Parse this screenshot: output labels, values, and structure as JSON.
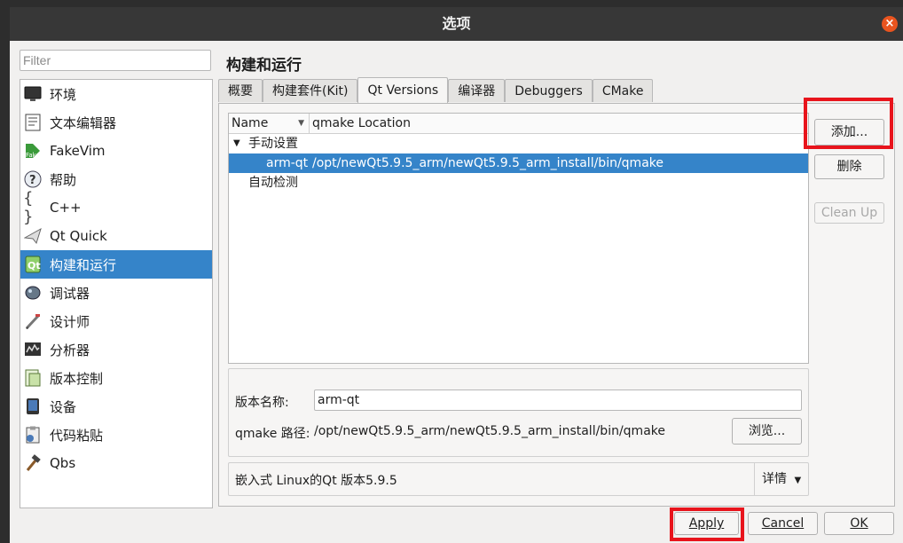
{
  "window": {
    "title": "选项"
  },
  "filter": {
    "placeholder": "Filter"
  },
  "sidebar": {
    "items": [
      {
        "label": "环境",
        "icon": "monitor-icon"
      },
      {
        "label": "文本编辑器",
        "icon": "text-editor-icon"
      },
      {
        "label": "FakeVim",
        "icon": "fakevim-icon"
      },
      {
        "label": "帮助",
        "icon": "help-icon"
      },
      {
        "label": "C++",
        "icon": "cpp-braces-icon"
      },
      {
        "label": "Qt Quick",
        "icon": "paper-plane-icon"
      },
      {
        "label": "构建和运行",
        "icon": "build-run-icon"
      },
      {
        "label": "调试器",
        "icon": "debugger-icon"
      },
      {
        "label": "设计师",
        "icon": "designer-icon"
      },
      {
        "label": "分析器",
        "icon": "analyzer-icon"
      },
      {
        "label": "版本控制",
        "icon": "version-control-icon"
      },
      {
        "label": "设备",
        "icon": "device-icon"
      },
      {
        "label": "代码粘贴",
        "icon": "code-paste-icon"
      },
      {
        "label": "Qbs",
        "icon": "hammer-icon"
      }
    ],
    "selected": "构建和运行"
  },
  "page": {
    "title": "构建和运行"
  },
  "tabs": [
    "概要",
    "构建套件(Kit)",
    "Qt Versions",
    "编译器",
    "Debuggers",
    "CMake"
  ],
  "active_tab": "Qt Versions",
  "table": {
    "columns": [
      "Name",
      "qmake Location"
    ],
    "group_manual": "手动设置",
    "row_name": "arm-qt",
    "row_location": "/opt/newQt5.9.5_arm/newQt5.9.5_arm_install/bin/qmake",
    "group_auto": "自动检测"
  },
  "buttons": {
    "add": "添加...",
    "remove": "删除",
    "cleanup": "Clean Up",
    "browse": "浏览...",
    "details": "详情",
    "apply": "Apply",
    "cancel": "Cancel",
    "ok": "OK"
  },
  "details": {
    "name_label": "版本名称:",
    "name_value": "arm-qt",
    "qmake_label": "qmake 路径:",
    "qmake_value": "/opt/newQt5.9.5_arm/newQt5.9.5_arm_install/bin/qmake",
    "info": "嵌入式 Linux的Qt 版本5.9.5"
  },
  "colors": {
    "selection": "#3584c9",
    "highlight_box": "#e8141c",
    "titlebar": "#373737"
  }
}
